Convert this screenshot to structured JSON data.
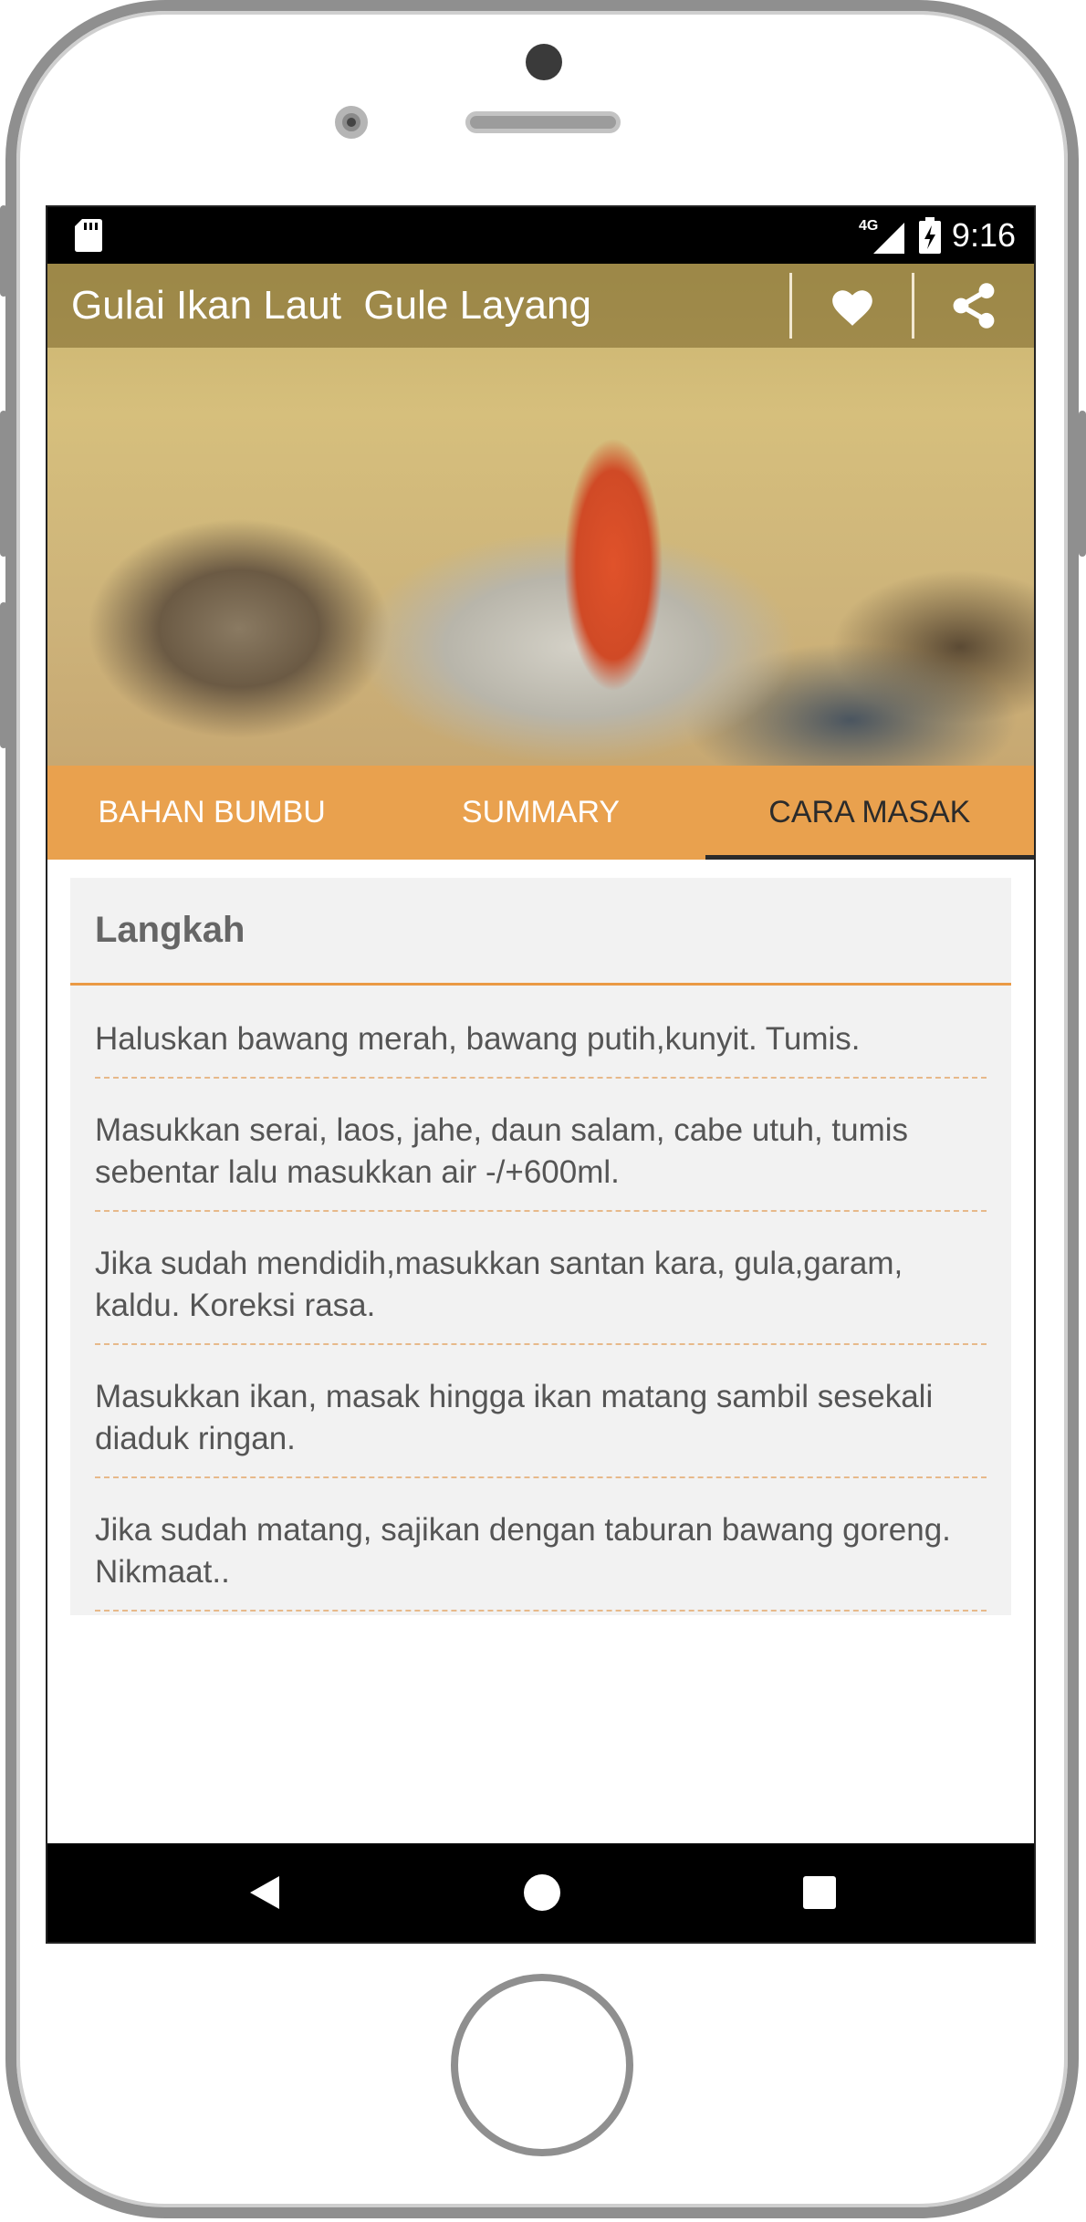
{
  "statusbar": {
    "network": "4G",
    "time": "9:16"
  },
  "appbar": {
    "title": "Gulai Ikan Laut  Gule Layang"
  },
  "tabs": [
    {
      "label": "BAHAN BUMBU",
      "active": false
    },
    {
      "label": "SUMMARY",
      "active": false
    },
    {
      "label": "CARA MASAK",
      "active": true
    }
  ],
  "card": {
    "header": "Langkah",
    "steps": [
      "Haluskan bawang merah, bawang putih,kunyit. Tumis.",
      "Masukkan serai, laos, jahe, daun salam, cabe utuh, tumis sebentar lalu masukkan air -/+600ml.",
      "Jika sudah mendidih,masukkan santan kara, gula,garam, kaldu. Koreksi rasa.",
      "Masukkan ikan, masak hingga ikan matang sambil sesekali diaduk ringan.",
      "Jika sudah matang, sajikan dengan taburan bawang goreng. Nikmaat.."
    ]
  },
  "colors": {
    "accent": "#e9a14e",
    "divider": "#ea9a45",
    "card_bg": "#f2f2f2"
  },
  "icons": {
    "favorite": "heart-icon",
    "share": "share-icon",
    "back": "back-icon",
    "home": "home-icon",
    "recents": "recents-icon",
    "sd_card": "sd-card-icon"
  }
}
